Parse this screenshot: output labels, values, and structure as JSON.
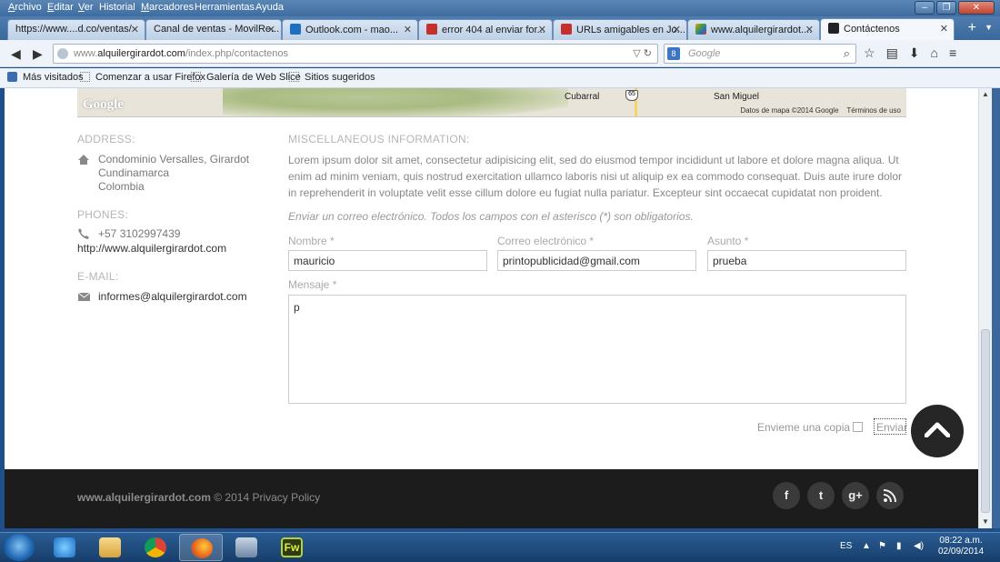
{
  "menubar": {
    "items": [
      {
        "hot": "A",
        "rest": "rchivo"
      },
      {
        "hot": "E",
        "rest": "ditar"
      },
      {
        "hot": "V",
        "rest": "er"
      },
      {
        "hot": "",
        "rest": "Historial"
      },
      {
        "hot": "M",
        "rest": "arcadores"
      },
      {
        "hot": "",
        "rest": "Herramientas"
      },
      {
        "hot": "",
        "rest": "Ayuda"
      }
    ]
  },
  "tabs": [
    {
      "title": "https://www....d.co/ventas/",
      "active": false
    },
    {
      "title": "Canal de ventas - MovilRe...",
      "active": false
    },
    {
      "title": "Outlook.com - mao...",
      "active": false
    },
    {
      "title": "error 404 al enviar for...",
      "active": false
    },
    {
      "title": "URLs amigables en Jo...",
      "active": false
    },
    {
      "title": "www.alquilergirardot....",
      "active": false
    },
    {
      "title": "Contáctenos",
      "active": true
    }
  ],
  "navbar": {
    "url_prefix": "www.",
    "url_domain": "alquilergirardot.com",
    "url_path": "/index.php/contactenos",
    "search_placeholder": "Google",
    "search_engine_icon": "google-icon"
  },
  "bookmarks": [
    {
      "label": "Más visitados"
    },
    {
      "label": "Comenzar a usar Firefox"
    },
    {
      "label": "Galería de Web Slice"
    },
    {
      "label": "Sitios sugeridos"
    }
  ],
  "map": {
    "logo": "Google",
    "places": [
      "Cubarral",
      "San Miguel"
    ],
    "route_number": "65",
    "credits": "Datos de mapa ©2014 Google",
    "terms": "Términos de uso"
  },
  "contact": {
    "address_heading": "ADDRESS:",
    "address_lines": [
      "Condominio Versalles, Girardot",
      "Cundinamarca",
      "Colombia"
    ],
    "phones_heading": "PHONES:",
    "phone": "+57 3102997439",
    "website": "http://www.alquilergirardot.com",
    "email_heading": "E-MAIL:",
    "email": "informes@alquilergirardot.com"
  },
  "misc": {
    "heading": "MISCELLANEOUS INFORMATION:",
    "body": "Lorem ipsum dolor sit amet, consectetur adipisicing elit, sed do eiusmod tempor incididunt ut labore et dolore magna aliqua. Ut enim ad minim veniam, quis nostrud exercitation ullamco laboris nisi ut aliquip ex ea commodo consequat. Duis aute irure dolor in reprehenderit in voluptate velit esse cillum dolore eu fugiat nulla pariatur. Excepteur sint occaecat cupidatat non proident."
  },
  "form": {
    "notice": "Enviar un correo electrónico. Todos los campos con el asterisco (*) son obligatorios.",
    "name_label": "Nombre *",
    "name_value": "mauricio",
    "email_label": "Correo electrónico *",
    "email_value": "printopublicidad@gmail.com",
    "subject_label": "Asunto *",
    "subject_value": "prueba",
    "message_label": "Mensaje *",
    "message_value": "p",
    "copy_label": "Envieme una copia",
    "copy_checked": false,
    "send_label": "Enviar"
  },
  "footer": {
    "site": "www.alquilergirardot.com",
    "rest": " © 2014 Privacy Policy",
    "social": [
      {
        "icon": "facebook-icon",
        "glyph": "f"
      },
      {
        "icon": "twitter-icon",
        "glyph": "t"
      },
      {
        "icon": "google-plus-icon",
        "glyph": "g+"
      },
      {
        "icon": "rss-icon",
        "glyph": "ɹ"
      }
    ]
  },
  "taskbar": {
    "language": "ES",
    "time": "08:22 a.m.",
    "date": "02/09/2014",
    "apps": [
      "internet-explorer-icon",
      "file-explorer-icon",
      "chrome-icon",
      "firefox-icon",
      "network-app-icon",
      "fireworks-icon"
    ]
  },
  "colors": {
    "footer_bg": "#1c1c1c",
    "muted_text": "#888888",
    "taskbar": "#1f4a7c"
  }
}
